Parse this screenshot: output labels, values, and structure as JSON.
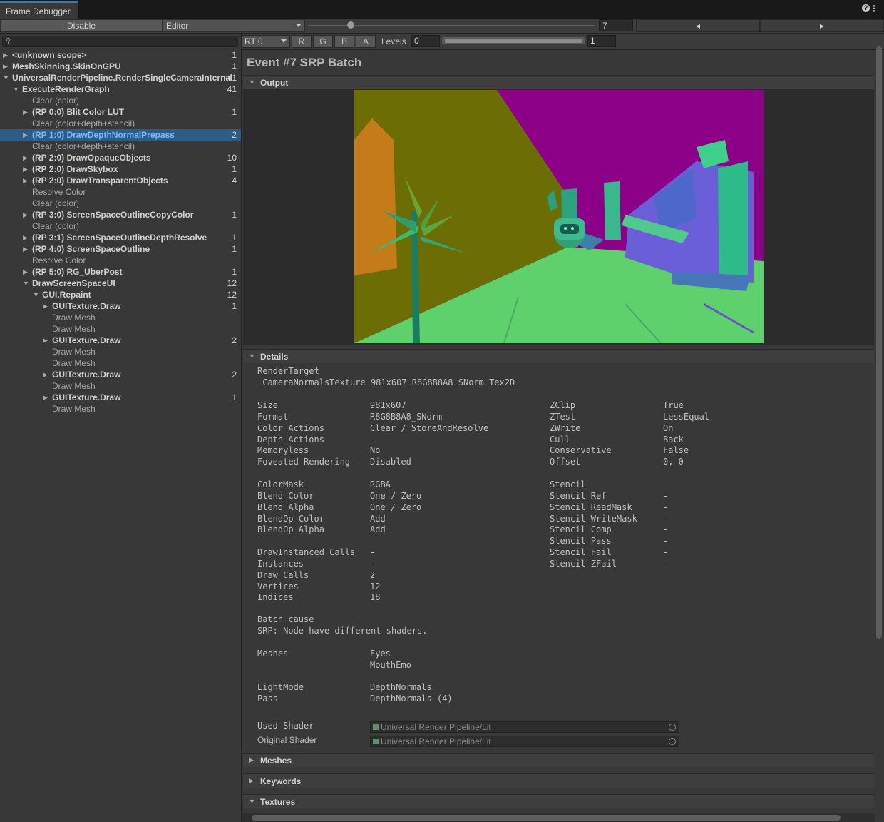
{
  "window": {
    "tab_title": "Frame Debugger"
  },
  "toolbar": {
    "disable_label": "Disable",
    "target_label": "Editor",
    "event_index": "7",
    "event_slider_fraction": 0.14
  },
  "search": {
    "placeholder": ""
  },
  "tree": [
    {
      "label": "<unknown scope>",
      "count": "1",
      "depth": 0,
      "expand": "collapsed",
      "bold": true
    },
    {
      "label": "MeshSkinning.SkinOnGPU",
      "count": "1",
      "depth": 0,
      "expand": "collapsed",
      "bold": true
    },
    {
      "label": "UniversalRenderPipeline.RenderSingleCameraInternal",
      "count": "41",
      "depth": 0,
      "expand": "expanded",
      "bold": true
    },
    {
      "label": "ExecuteRenderGraph",
      "count": "41",
      "depth": 1,
      "expand": "expanded",
      "bold": true
    },
    {
      "label": "Clear (color)",
      "count": "",
      "depth": 2,
      "expand": "none",
      "bold": false
    },
    {
      "label": "(RP 0:0) Blit Color LUT",
      "count": "1",
      "depth": 2,
      "expand": "collapsed",
      "bold": true
    },
    {
      "label": "Clear (color+depth+stencil)",
      "count": "",
      "depth": 2,
      "expand": "none",
      "bold": false
    },
    {
      "label": "(RP 1:0) DrawDepthNormalPrepass",
      "count": "2",
      "depth": 2,
      "expand": "collapsed",
      "bold": true,
      "selected": true
    },
    {
      "label": "Clear (color+depth+stencil)",
      "count": "",
      "depth": 2,
      "expand": "none",
      "bold": false
    },
    {
      "label": "(RP 2:0) DrawOpaqueObjects",
      "count": "10",
      "depth": 2,
      "expand": "collapsed",
      "bold": true
    },
    {
      "label": "(RP 2:0) DrawSkybox",
      "count": "1",
      "depth": 2,
      "expand": "collapsed",
      "bold": true
    },
    {
      "label": "(RP 2:0) DrawTransparentObjects",
      "count": "4",
      "depth": 2,
      "expand": "collapsed",
      "bold": true
    },
    {
      "label": "Resolve Color",
      "count": "",
      "depth": 2,
      "expand": "none",
      "bold": false
    },
    {
      "label": "Clear (color)",
      "count": "",
      "depth": 2,
      "expand": "none",
      "bold": false
    },
    {
      "label": "(RP 3:0) ScreenSpaceOutlineCopyColor",
      "count": "1",
      "depth": 2,
      "expand": "collapsed",
      "bold": true
    },
    {
      "label": "Clear (color)",
      "count": "",
      "depth": 2,
      "expand": "none",
      "bold": false
    },
    {
      "label": "(RP 3:1) ScreenSpaceOutlineDepthResolve",
      "count": "1",
      "depth": 2,
      "expand": "collapsed",
      "bold": true
    },
    {
      "label": "(RP 4:0) ScreenSpaceOutline",
      "count": "1",
      "depth": 2,
      "expand": "collapsed",
      "bold": true
    },
    {
      "label": "Resolve Color",
      "count": "",
      "depth": 2,
      "expand": "none",
      "bold": false
    },
    {
      "label": "(RP 5:0) RG_UberPost",
      "count": "1",
      "depth": 2,
      "expand": "collapsed",
      "bold": true
    },
    {
      "label": "DrawScreenSpaceUI",
      "count": "12",
      "depth": 2,
      "expand": "expanded",
      "bold": true
    },
    {
      "label": "GUI.Repaint",
      "count": "12",
      "depth": 3,
      "expand": "expanded",
      "bold": true
    },
    {
      "label": "GUITexture.Draw",
      "count": "1",
      "depth": 4,
      "expand": "collapsed",
      "bold": true
    },
    {
      "label": "Draw Mesh",
      "count": "",
      "depth": 4,
      "expand": "none",
      "bold": false
    },
    {
      "label": "Draw Mesh",
      "count": "",
      "depth": 4,
      "expand": "none",
      "bold": false
    },
    {
      "label": "GUITexture.Draw",
      "count": "2",
      "depth": 4,
      "expand": "collapsed",
      "bold": true
    },
    {
      "label": "Draw Mesh",
      "count": "",
      "depth": 4,
      "expand": "none",
      "bold": false
    },
    {
      "label": "Draw Mesh",
      "count": "",
      "depth": 4,
      "expand": "none",
      "bold": false
    },
    {
      "label": "GUITexture.Draw",
      "count": "2",
      "depth": 4,
      "expand": "collapsed",
      "bold": true
    },
    {
      "label": "Draw Mesh",
      "count": "",
      "depth": 4,
      "expand": "none",
      "bold": false
    },
    {
      "label": "GUITexture.Draw",
      "count": "1",
      "depth": 4,
      "expand": "collapsed",
      "bold": true
    },
    {
      "label": "Draw Mesh",
      "count": "",
      "depth": 4,
      "expand": "none",
      "bold": false
    }
  ],
  "preview_toolbar": {
    "rt_label": "RT 0",
    "channels": [
      "R",
      "G",
      "B",
      "A"
    ],
    "levels_label": "Levels",
    "levels_min": "0",
    "levels_max": "1"
  },
  "event": {
    "title": "Event #7 SRP Batch"
  },
  "sections": {
    "output": "Output",
    "details": "Details",
    "meshes": "Meshes",
    "keywords": "Keywords",
    "textures": "Textures"
  },
  "details": {
    "render_target_label": "RenderTarget",
    "render_target_value": "_CameraNormalsTexture_981x607_R8G8B8A8_SNorm_Tex2D",
    "left": [
      [
        "Size",
        "981x607"
      ],
      [
        "Format",
        "R8G8B8A8_SNorm"
      ],
      [
        "Color Actions",
        "Clear / StoreAndResolve"
      ],
      [
        "Depth Actions",
        "-"
      ],
      [
        "Memoryless",
        "No"
      ],
      [
        "Foveated Rendering",
        "Disabled"
      ],
      [
        "",
        ""
      ],
      [
        "ColorMask",
        "RGBA"
      ],
      [
        "Blend Color",
        "One / Zero"
      ],
      [
        "Blend Alpha",
        "One / Zero"
      ],
      [
        "BlendOp Color",
        "Add"
      ],
      [
        "BlendOp Alpha",
        "Add"
      ],
      [
        "",
        ""
      ],
      [
        "DrawInstanced Calls",
        "-"
      ],
      [
        "Instances",
        "-"
      ],
      [
        "Draw Calls",
        "2"
      ],
      [
        "Vertices",
        "12"
      ],
      [
        "Indices",
        "18"
      ]
    ],
    "right": [
      [
        "ZClip",
        "True"
      ],
      [
        "ZTest",
        "LessEqual"
      ],
      [
        "ZWrite",
        "On"
      ],
      [
        "Cull",
        "Back"
      ],
      [
        "Conservative",
        "False"
      ],
      [
        "Offset",
        "0, 0"
      ],
      [
        "",
        ""
      ],
      [
        "Stencil",
        ""
      ],
      [
        "Stencil Ref",
        "-"
      ],
      [
        "Stencil ReadMask",
        "-"
      ],
      [
        "Stencil WriteMask",
        "-"
      ],
      [
        "Stencil Comp",
        "-"
      ],
      [
        "Stencil Pass",
        "-"
      ],
      [
        "Stencil Fail",
        "-"
      ],
      [
        "Stencil ZFail",
        "-"
      ]
    ],
    "batch_cause_label": "Batch cause",
    "batch_cause_value": "SRP: Node have different shaders.",
    "meshes_label": "Meshes",
    "meshes_values": [
      "Eyes",
      "MouthEmo"
    ],
    "lightmode_label": "LightMode",
    "lightmode_value": "DepthNormals",
    "pass_label": "Pass",
    "pass_value": "DepthNormals (4)",
    "used_shader_label": "Used Shader",
    "used_shader_value": "Universal Render Pipeline/Lit",
    "original_shader_label": "Original Shader",
    "original_shader_value": "Universal Render Pipeline/Lit"
  },
  "colors": {
    "accent": "#3a79bb",
    "selection": "#2c5d87",
    "selected_text": "#7ab8ff"
  }
}
